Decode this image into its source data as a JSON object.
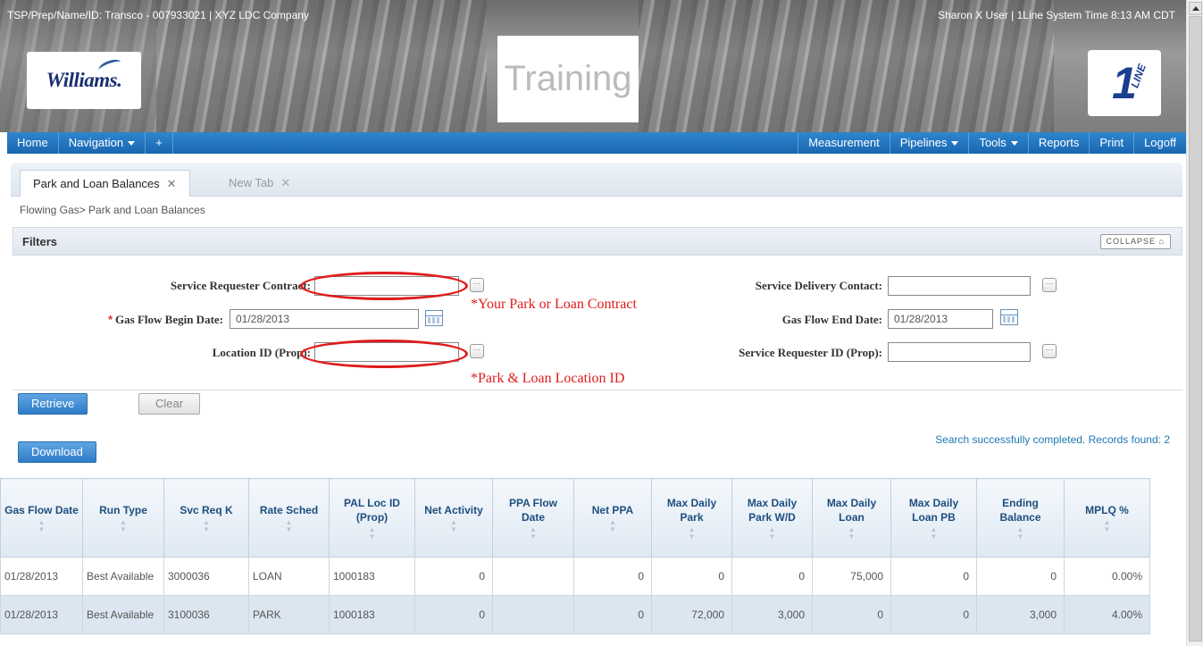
{
  "header": {
    "tsp_info": "TSP/Prep/Name/ID: Transco - 007933021  |  XYZ LDC Company",
    "user_info": "Sharon X User  |  1Line System Time   8:13 AM CDT",
    "williams_logo_text": "Williams.",
    "training_label": "Training",
    "oneline_logo_text": "1",
    "oneline_logo_sub": "LINE"
  },
  "nav": {
    "home": "Home",
    "navigation": "Navigation",
    "add": "+",
    "measurement": "Measurement",
    "pipelines": "Pipelines",
    "tools": "Tools",
    "reports": "Reports",
    "print": "Print",
    "logoff": "Logoff"
  },
  "tabs": [
    {
      "label": "Park and Loan Balances",
      "close": "✕",
      "active": true
    },
    {
      "label": "New Tab",
      "close": "✕",
      "active": false
    }
  ],
  "breadcrumb": "Flowing Gas>  Park and Loan Balances",
  "filters": {
    "title": "Filters",
    "collapse_label": "COLLAPSE",
    "service_requester_contract": {
      "label": "Service Requester Contract:",
      "value": ""
    },
    "gas_flow_begin_date": {
      "label": "Gas Flow Begin Date:",
      "value": "01/28/2013",
      "required_mark": "*"
    },
    "location_id": {
      "label": "Location ID (Prop):",
      "value": ""
    },
    "service_delivery_contact": {
      "label": "Service Delivery Contact:",
      "value": ""
    },
    "gas_flow_end_date": {
      "label": "Gas Flow End Date:",
      "value": "01/28/2013"
    },
    "service_requester_id": {
      "label": "Service Requester ID (Prop):",
      "value": ""
    },
    "lookup_glyph": "···"
  },
  "annotations": {
    "contract_note": "*Your Park or Loan Contract",
    "location_note": "*Park & Loan Location ID",
    "highlight_color": "#e01b1b"
  },
  "buttons": {
    "retrieve": "Retrieve",
    "clear": "Clear",
    "download": "Download"
  },
  "status_message": "Search successfully completed. Records found: 2",
  "table": {
    "columns": [
      "Gas Flow Date",
      "Run Type",
      "Svc Req K",
      "Rate Sched",
      "PAL Loc ID (Prop)",
      "Net Activity",
      "PPA Flow Date",
      "Net PPA",
      "Max Daily Park",
      "Max Daily Park W/D",
      "Max Daily Loan",
      "Max Daily Loan PB",
      "Ending Balance",
      "MPLQ %"
    ],
    "rows": [
      [
        "01/28/2013",
        "Best Available",
        "3000036",
        "LOAN",
        "1000183",
        "0",
        "",
        "0",
        "0",
        "0",
        "75,000",
        "0",
        "0",
        "0.00%"
      ],
      [
        "01/28/2013",
        "Best Available",
        "3100036",
        "PARK",
        "1000183",
        "0",
        "",
        "0",
        "72,000",
        "3,000",
        "0",
        "0",
        "3,000",
        "4.00%"
      ]
    ]
  },
  "colors": {
    "nav_blue": "#1a66b0",
    "link_blue": "#1f77b4",
    "row_alt": "#dce6f0"
  }
}
